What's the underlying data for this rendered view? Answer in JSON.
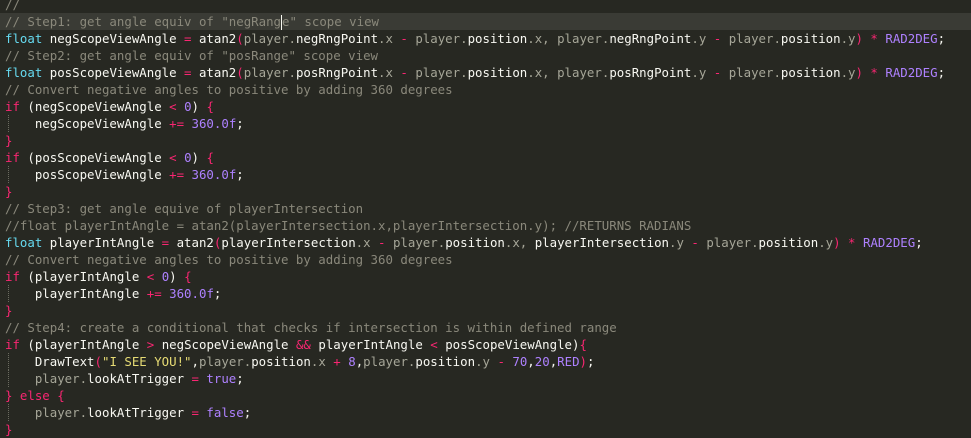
{
  "colors": {
    "background": "#272822",
    "comment": "#8a887b",
    "type_keyword": "#66d9ef",
    "control_keyword": "#f92672",
    "number": "#ae81ff",
    "string": "#e6db74",
    "identifier": "#f8f8f2",
    "member_access": "#a6a698"
  },
  "code_lines": [
    {
      "guide": false,
      "tokens": [
        [
          "c",
          "//   "
        ]
      ]
    },
    {
      "guide": false,
      "current": true,
      "tokens": [
        [
          "c",
          "// Step1: get angle equiv of \"negRang"
        ],
        [
          "cursor",
          ""
        ],
        [
          "c",
          "e\" scope view"
        ]
      ]
    },
    {
      "guide": false,
      "tokens": [
        [
          "k",
          "float "
        ],
        [
          "v",
          "negScopeViewAngle "
        ],
        [
          "kw",
          "= "
        ],
        [
          "v",
          "atan2"
        ],
        [
          "kw",
          "("
        ],
        [
          "p",
          "player."
        ],
        [
          "v",
          "negRngPoint"
        ],
        [
          "p",
          ".x "
        ],
        [
          "kw",
          "- "
        ],
        [
          "p",
          "player."
        ],
        [
          "v",
          "position"
        ],
        [
          "p",
          ".x, player."
        ],
        [
          "v",
          "negRngPoint"
        ],
        [
          "p",
          ".y "
        ],
        [
          "kw",
          "- "
        ],
        [
          "p",
          "player."
        ],
        [
          "v",
          "position"
        ],
        [
          "p",
          ".y"
        ],
        [
          "kw",
          ") * "
        ],
        [
          "n",
          "RAD2DEG"
        ],
        [
          "v",
          ";"
        ]
      ]
    },
    {
      "guide": false,
      "tokens": [
        [
          "c",
          "// Step2: get angle equiv of \"posRange\" scope view"
        ]
      ]
    },
    {
      "guide": false,
      "tokens": [
        [
          "k",
          "float "
        ],
        [
          "v",
          "posScopeViewAngle "
        ],
        [
          "kw",
          "= "
        ],
        [
          "v",
          "atan2"
        ],
        [
          "kw",
          "("
        ],
        [
          "p",
          "player."
        ],
        [
          "v",
          "posRngPoint"
        ],
        [
          "p",
          ".x "
        ],
        [
          "kw",
          "- "
        ],
        [
          "p",
          "player."
        ],
        [
          "v",
          "position"
        ],
        [
          "p",
          ".x, player."
        ],
        [
          "v",
          "posRngPoint"
        ],
        [
          "p",
          ".y "
        ],
        [
          "kw",
          "- "
        ],
        [
          "p",
          "player."
        ],
        [
          "v",
          "position"
        ],
        [
          "p",
          ".y"
        ],
        [
          "kw",
          ") * "
        ],
        [
          "n",
          "RAD2DEG"
        ],
        [
          "v",
          ";"
        ]
      ]
    },
    {
      "guide": false,
      "tokens": [
        [
          "c",
          "// Convert negative angles to positive by adding 360 degrees"
        ]
      ]
    },
    {
      "guide": false,
      "tokens": [
        [
          "kw",
          "if "
        ],
        [
          "v",
          "("
        ],
        [
          "v",
          "negScopeViewAngle "
        ],
        [
          "kw",
          "< "
        ],
        [
          "n",
          "0"
        ],
        [
          "v",
          ") "
        ],
        [
          "kw",
          "{"
        ]
      ]
    },
    {
      "guide": true,
      "tokens": [
        [
          "v",
          "    negScopeViewAngle "
        ],
        [
          "kw",
          "+= "
        ],
        [
          "n",
          "360.0f"
        ],
        [
          "v",
          ";"
        ]
      ]
    },
    {
      "guide": false,
      "tokens": [
        [
          "r",
          "}"
        ]
      ]
    },
    {
      "guide": false,
      "tokens": [
        [
          "kw",
          "if "
        ],
        [
          "v",
          "("
        ],
        [
          "v",
          "posScopeViewAngle "
        ],
        [
          "kw",
          "< "
        ],
        [
          "n",
          "0"
        ],
        [
          "v",
          ") "
        ],
        [
          "kw",
          "{"
        ]
      ]
    },
    {
      "guide": true,
      "tokens": [
        [
          "v",
          "    posScopeViewAngle "
        ],
        [
          "kw",
          "+= "
        ],
        [
          "n",
          "360.0f"
        ],
        [
          "v",
          ";"
        ]
      ]
    },
    {
      "guide": false,
      "tokens": [
        [
          "r",
          "}"
        ]
      ]
    },
    {
      "guide": false,
      "tokens": [
        [
          "c",
          "// Step3: get angle equive of playerIntersection"
        ]
      ]
    },
    {
      "guide": false,
      "tokens": [
        [
          "c",
          "//float playerIntAngle = atan2(playerIntersection.x,playerIntersection.y); //RETURNS RADIANS"
        ]
      ]
    },
    {
      "guide": false,
      "tokens": [
        [
          "k",
          "float "
        ],
        [
          "v",
          "playerIntAngle "
        ],
        [
          "kw",
          "= "
        ],
        [
          "v",
          "atan2"
        ],
        [
          "kw",
          "("
        ],
        [
          "v",
          "playerIntersection"
        ],
        [
          "p",
          ".x "
        ],
        [
          "kw",
          "- "
        ],
        [
          "p",
          "player."
        ],
        [
          "v",
          "position"
        ],
        [
          "p",
          ".x, "
        ],
        [
          "v",
          "playerIntersection"
        ],
        [
          "p",
          ".y "
        ],
        [
          "kw",
          "- "
        ],
        [
          "p",
          "player."
        ],
        [
          "v",
          "position"
        ],
        [
          "p",
          ".y"
        ],
        [
          "kw",
          ") * "
        ],
        [
          "n",
          "RAD2DEG"
        ],
        [
          "v",
          ";"
        ]
      ]
    },
    {
      "guide": false,
      "tokens": [
        [
          "c",
          "// Convert negative angles to positive by adding 360 degrees"
        ]
      ]
    },
    {
      "guide": false,
      "tokens": [
        [
          "kw",
          "if "
        ],
        [
          "v",
          "("
        ],
        [
          "v",
          "playerIntAngle "
        ],
        [
          "kw",
          "< "
        ],
        [
          "n",
          "0"
        ],
        [
          "v",
          ") "
        ],
        [
          "kw",
          "{"
        ]
      ]
    },
    {
      "guide": true,
      "tokens": [
        [
          "v",
          "    playerIntAngle "
        ],
        [
          "kw",
          "+= "
        ],
        [
          "n",
          "360.0f"
        ],
        [
          "v",
          ";"
        ]
      ]
    },
    {
      "guide": false,
      "tokens": [
        [
          "r",
          "}"
        ]
      ]
    },
    {
      "guide": false,
      "tokens": [
        [
          "c",
          "// Step4: create a conditional that checks if intersection is within defined range"
        ]
      ]
    },
    {
      "guide": false,
      "tokens": [
        [
          "kw",
          "if "
        ],
        [
          "v",
          "("
        ],
        [
          "v",
          "playerIntAngle "
        ],
        [
          "kw",
          "> "
        ],
        [
          "v",
          "negScopeViewAngle "
        ],
        [
          "kw",
          "&& "
        ],
        [
          "v",
          "playerIntAngle "
        ],
        [
          "kw",
          "< "
        ],
        [
          "v",
          "posScopeViewAngle"
        ],
        [
          "v",
          ")"
        ],
        [
          "kw",
          "{"
        ]
      ]
    },
    {
      "guide": true,
      "tokens": [
        [
          "v",
          "    DrawText"
        ],
        [
          "kw",
          "("
        ],
        [
          "s",
          "\"I SEE YOU!\""
        ],
        [
          "v",
          ","
        ],
        [
          "p",
          "player."
        ],
        [
          "v",
          "position"
        ],
        [
          "p",
          ".x "
        ],
        [
          "kw",
          "+ "
        ],
        [
          "n",
          "8"
        ],
        [
          "v",
          ","
        ],
        [
          "p",
          "player."
        ],
        [
          "v",
          "position"
        ],
        [
          "p",
          ".y "
        ],
        [
          "kw",
          "- "
        ],
        [
          "n",
          "70"
        ],
        [
          "v",
          ","
        ],
        [
          "n",
          "20"
        ],
        [
          "v",
          ","
        ],
        [
          "n",
          "RED"
        ],
        [
          "kw",
          ")"
        ],
        [
          "v",
          ";"
        ]
      ]
    },
    {
      "guide": true,
      "tokens": [
        [
          "p",
          "    player."
        ],
        [
          "v",
          "lookAtTrigger "
        ],
        [
          "kw",
          "= "
        ],
        [
          "n",
          "true"
        ],
        [
          "v",
          ";"
        ]
      ]
    },
    {
      "guide": false,
      "tokens": [
        [
          "kw",
          "} else {"
        ]
      ]
    },
    {
      "guide": true,
      "tokens": [
        [
          "p",
          "    player."
        ],
        [
          "v",
          "lookAtTrigger "
        ],
        [
          "kw",
          "= "
        ],
        [
          "n",
          "false"
        ],
        [
          "v",
          ";"
        ]
      ]
    },
    {
      "guide": false,
      "tokens": [
        [
          "r",
          "}"
        ]
      ]
    }
  ]
}
